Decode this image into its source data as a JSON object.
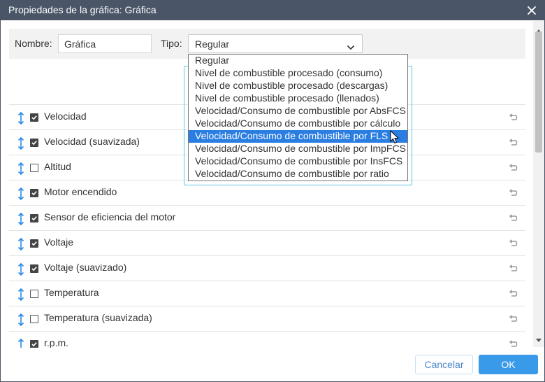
{
  "dialog": {
    "title": "Propiedades de la gráfica: Gráfica"
  },
  "form": {
    "name_label": "Nombre:",
    "name_value": "Gráfica",
    "type_label": "Tipo:",
    "type_value": "Regular"
  },
  "dropdown": {
    "options": [
      "Regular",
      "Nivel de combustible procesado (consumo)",
      "Nivel de combustible procesado (descargas)",
      "Nivel de combustible procesado (llenados)",
      "Velocidad/Consumo de combustible por AbsFCS",
      "Velocidad/Consumo de combustible por cálculo",
      "Velocidad/Consumo de combustible por FLS",
      "Velocidad/Consumo de combustible por ImpFCS",
      "Velocidad/Consumo de combustible por InsFCS",
      "Velocidad/Consumo de combustible por ratio"
    ],
    "highlighted": "Velocidad/Consumo de combustible por FLS"
  },
  "rows": [
    {
      "label": "Velocidad",
      "checked": true
    },
    {
      "label": "Velocidad (suavizada)",
      "checked": true
    },
    {
      "label": "Altitud",
      "checked": false
    },
    {
      "label": "Motor encendido",
      "checked": true
    },
    {
      "label": "Sensor de eficiencia del motor",
      "checked": true
    },
    {
      "label": "Voltaje",
      "checked": true
    },
    {
      "label": "Voltaje (suavizado)",
      "checked": true
    },
    {
      "label": "Temperatura",
      "checked": false
    },
    {
      "label": "Temperatura (suavizada)",
      "checked": false
    },
    {
      "label": "r.p.m.",
      "checked": true
    }
  ],
  "buttons": {
    "cancel": "Cancelar",
    "ok": "OK"
  },
  "colors": {
    "titlebar": "#4a5668",
    "accent": "#3a9aea",
    "highlight": "#2a7de1",
    "drag_icon": "#2a8ae6"
  }
}
